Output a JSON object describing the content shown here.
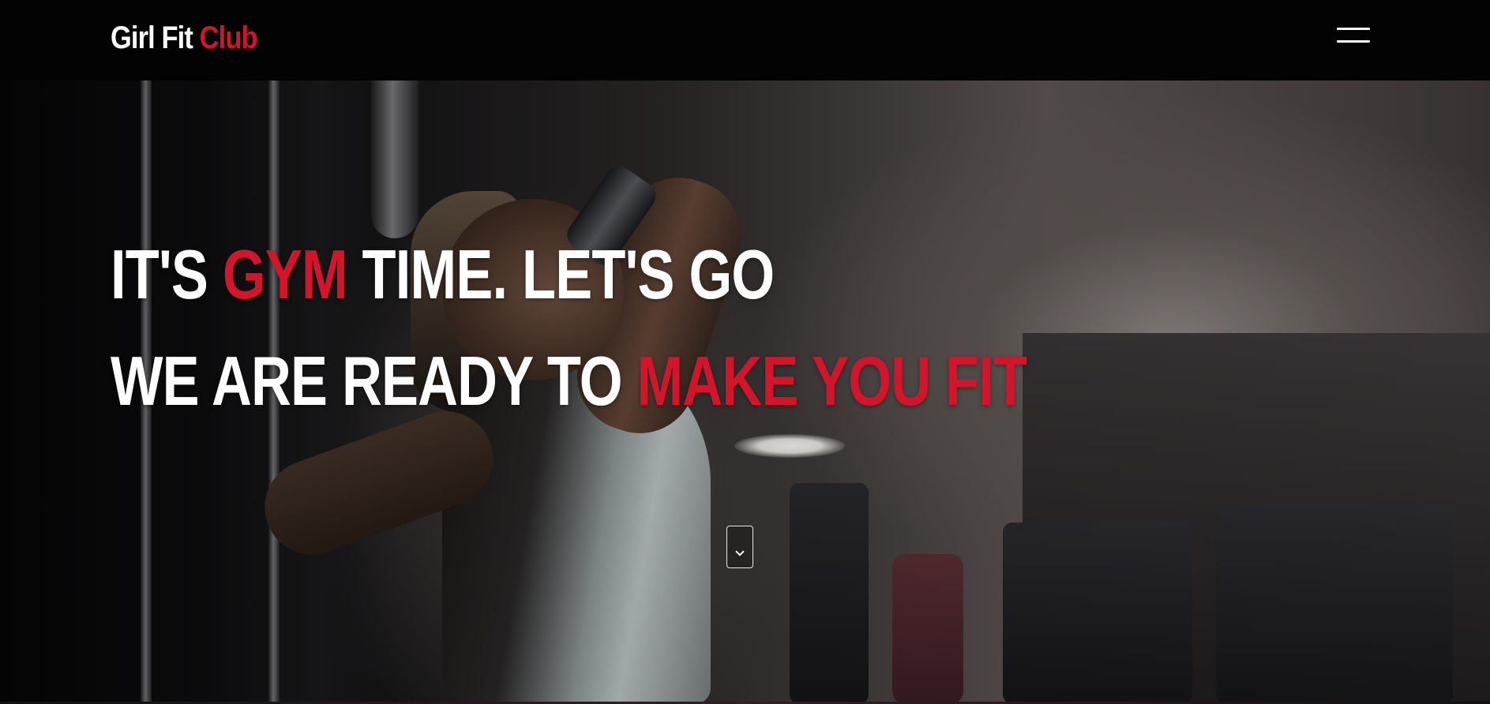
{
  "header": {
    "brand_part1": "Girl Fit ",
    "brand_part2": "Club",
    "menu_icon": "hamburger-menu-icon"
  },
  "hero": {
    "line1_part1": "IT'S ",
    "line1_accent": "GYM",
    "line1_part2": " TIME. LET'S GO",
    "line2_part1": "WE ARE READY TO ",
    "line2_accent": "MAKE YOU FIT",
    "scroll_icon": "chevron-down-icon"
  },
  "colors": {
    "accent": "#d2152b",
    "header_bg": "#030303",
    "text": "#ffffff"
  }
}
